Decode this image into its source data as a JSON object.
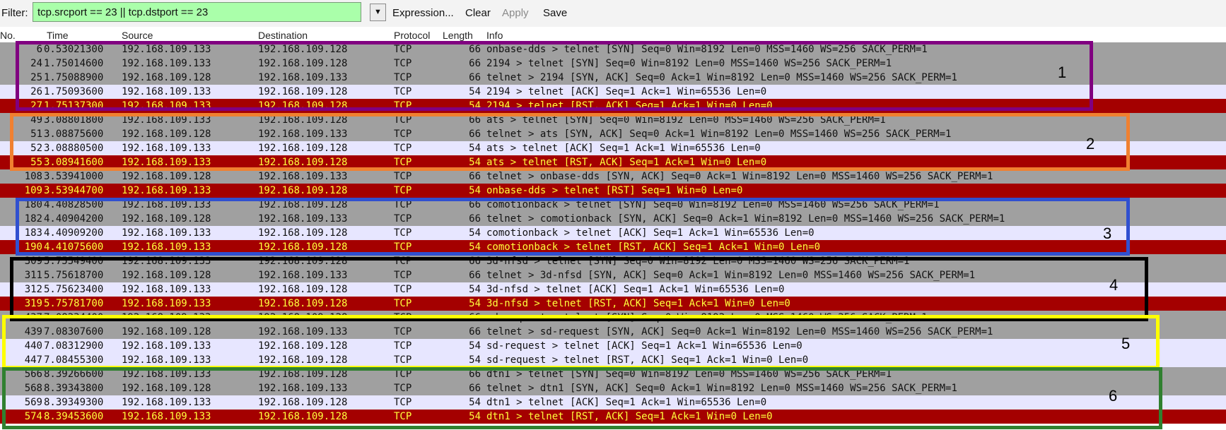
{
  "filter": {
    "label": "Filter:",
    "value": "tcp.srcport == 23 || tcp.dstport == 23",
    "dropdown_icon": "triangle-down"
  },
  "toolbar": {
    "expression": "Expression...",
    "clear": "Clear",
    "apply": "Apply",
    "save": "Save"
  },
  "columns": {
    "no": "No.",
    "time": "Time",
    "source": "Source",
    "destination": "Destination",
    "protocol": "Protocol",
    "length": "Length",
    "info": "Info"
  },
  "colors": {
    "syn_row": "#a0a0a0",
    "ack_row": "#e7e6ff",
    "rst_row": "#a40000",
    "rst_text": "#ffff3c",
    "filter_bg": "#aaffaa"
  },
  "packets": [
    {
      "no": "6",
      "time": "0.53021300",
      "src": "192.168.109.133",
      "dst": "192.168.109.128",
      "proto": "TCP",
      "len": "66",
      "info": "onbase-dds > telnet [SYN] Seq=0 Win=8192 Len=0 MSS=1460 WS=256 SACK_PERM=1",
      "kind": "syn"
    },
    {
      "no": "24",
      "time": "1.75014600",
      "src": "192.168.109.133",
      "dst": "192.168.109.128",
      "proto": "TCP",
      "len": "66",
      "info": "2194 > telnet [SYN] Seq=0 Win=8192 Len=0 MSS=1460 WS=256 SACK_PERM=1",
      "kind": "syn"
    },
    {
      "no": "25",
      "time": "1.75088900",
      "src": "192.168.109.128",
      "dst": "192.168.109.133",
      "proto": "TCP",
      "len": "66",
      "info": "telnet > 2194 [SYN, ACK] Seq=0 Ack=1 Win=8192 Len=0 MSS=1460 WS=256 SACK_PERM=1",
      "kind": "synack"
    },
    {
      "no": "26",
      "time": "1.75093600",
      "src": "192.168.109.133",
      "dst": "192.168.109.128",
      "proto": "TCP",
      "len": "54",
      "info": "2194 > telnet [ACK] Seq=1 Ack=1 Win=65536 Len=0",
      "kind": "ack"
    },
    {
      "no": "27",
      "time": "1.75137300",
      "src": "192.168.109.133",
      "dst": "192.168.109.128",
      "proto": "TCP",
      "len": "54",
      "info": "2194 > telnet [RST, ACK] Seq=1 Ack=1 Win=0 Len=0",
      "kind": "rst"
    },
    {
      "no": "49",
      "time": "3.08801800",
      "src": "192.168.109.133",
      "dst": "192.168.109.128",
      "proto": "TCP",
      "len": "66",
      "info": "ats > telnet [SYN] Seq=0 Win=8192 Len=0 MSS=1460 WS=256 SACK_PERM=1",
      "kind": "syn"
    },
    {
      "no": "51",
      "time": "3.08875600",
      "src": "192.168.109.128",
      "dst": "192.168.109.133",
      "proto": "TCP",
      "len": "66",
      "info": "telnet > ats [SYN, ACK] Seq=0 Ack=1 Win=8192 Len=0 MSS=1460 WS=256 SACK_PERM=1",
      "kind": "synack"
    },
    {
      "no": "52",
      "time": "3.08880500",
      "src": "192.168.109.133",
      "dst": "192.168.109.128",
      "proto": "TCP",
      "len": "54",
      "info": "ats > telnet [ACK] Seq=1 Ack=1 Win=65536 Len=0",
      "kind": "ack"
    },
    {
      "no": "55",
      "time": "3.08941600",
      "src": "192.168.109.133",
      "dst": "192.168.109.128",
      "proto": "TCP",
      "len": "54",
      "info": "ats > telnet [RST, ACK] Seq=1 Ack=1 Win=0 Len=0",
      "kind": "rst"
    },
    {
      "no": "108",
      "time": "3.53941000",
      "src": "192.168.109.128",
      "dst": "192.168.109.133",
      "proto": "TCP",
      "len": "66",
      "info": "telnet > onbase-dds [SYN, ACK] Seq=0 Ack=1 Win=8192 Len=0 MSS=1460 WS=256 SACK_PERM=1",
      "kind": "synack"
    },
    {
      "no": "109",
      "time": "3.53944700",
      "src": "192.168.109.133",
      "dst": "192.168.109.128",
      "proto": "TCP",
      "len": "54",
      "info": "onbase-dds > telnet [RST] Seq=1 Win=0 Len=0",
      "kind": "rst"
    },
    {
      "no": "180",
      "time": "4.40828500",
      "src": "192.168.109.133",
      "dst": "192.168.109.128",
      "proto": "TCP",
      "len": "66",
      "info": "comotionback > telnet [SYN] Seq=0 Win=8192 Len=0 MSS=1460 WS=256 SACK_PERM=1",
      "kind": "syn"
    },
    {
      "no": "182",
      "time": "4.40904200",
      "src": "192.168.109.128",
      "dst": "192.168.109.133",
      "proto": "TCP",
      "len": "66",
      "info": "telnet > comotionback [SYN, ACK] Seq=0 Ack=1 Win=8192 Len=0 MSS=1460 WS=256 SACK_PERM=1",
      "kind": "synack"
    },
    {
      "no": "183",
      "time": "4.40909200",
      "src": "192.168.109.133",
      "dst": "192.168.109.128",
      "proto": "TCP",
      "len": "54",
      "info": "comotionback > telnet [ACK] Seq=1 Ack=1 Win=65536 Len=0",
      "kind": "ack"
    },
    {
      "no": "190",
      "time": "4.41075600",
      "src": "192.168.109.133",
      "dst": "192.168.109.128",
      "proto": "TCP",
      "len": "54",
      "info": "comotionback > telnet [RST, ACK] Seq=1 Ack=1 Win=0 Len=0",
      "kind": "rst"
    },
    {
      "no": "309",
      "time": "5.75549400",
      "src": "192.168.109.133",
      "dst": "192.168.109.128",
      "proto": "TCP",
      "len": "66",
      "info": "3d-nfsd > telnet [SYN] Seq=0 Win=8192 Len=0 MSS=1460 WS=256 SACK_PERM=1",
      "kind": "syn"
    },
    {
      "no": "311",
      "time": "5.75618700",
      "src": "192.168.109.128",
      "dst": "192.168.109.133",
      "proto": "TCP",
      "len": "66",
      "info": "telnet > 3d-nfsd [SYN, ACK] Seq=0 Ack=1 Win=8192 Len=0 MSS=1460 WS=256 SACK_PERM=1",
      "kind": "synack"
    },
    {
      "no": "312",
      "time": "5.75623400",
      "src": "192.168.109.133",
      "dst": "192.168.109.128",
      "proto": "TCP",
      "len": "54",
      "info": "3d-nfsd > telnet [ACK] Seq=1 Ack=1 Win=65536 Len=0",
      "kind": "ack"
    },
    {
      "no": "319",
      "time": "5.75781700",
      "src": "192.168.109.133",
      "dst": "192.168.109.128",
      "proto": "TCP",
      "len": "54",
      "info": "3d-nfsd > telnet [RST, ACK] Seq=1 Ack=1 Win=0 Len=0",
      "kind": "rst"
    },
    {
      "no": "437",
      "time": "7.08234400",
      "src": "192.168.109.133",
      "dst": "192.168.109.128",
      "proto": "TCP",
      "len": "66",
      "info": "sd-request > telnet [SYN] Seq=0 Win=8192 Len=0 MSS=1460 WS=256 SACK_PERM=1",
      "kind": "syn"
    },
    {
      "no": "439",
      "time": "7.08307600",
      "src": "192.168.109.128",
      "dst": "192.168.109.133",
      "proto": "TCP",
      "len": "66",
      "info": "telnet > sd-request [SYN, ACK] Seq=0 Ack=1 Win=8192 Len=0 MSS=1460 WS=256 SACK_PERM=1",
      "kind": "synack"
    },
    {
      "no": "440",
      "time": "7.08312900",
      "src": "192.168.109.133",
      "dst": "192.168.109.128",
      "proto": "TCP",
      "len": "54",
      "info": "sd-request > telnet [ACK] Seq=1 Ack=1 Win=65536 Len=0",
      "kind": "ack"
    },
    {
      "no": "447",
      "time": "7.08455300",
      "src": "192.168.109.133",
      "dst": "192.168.109.128",
      "proto": "TCP",
      "len": "54",
      "info": "sd-request > telnet [RST, ACK] Seq=1 Ack=1 Win=0 Len=0",
      "kind": "ack"
    },
    {
      "no": "566",
      "time": "8.39266600",
      "src": "192.168.109.133",
      "dst": "192.168.109.128",
      "proto": "TCP",
      "len": "66",
      "info": "dtn1 > telnet [SYN] Seq=0 Win=8192 Len=0 MSS=1460 WS=256 SACK_PERM=1",
      "kind": "syn"
    },
    {
      "no": "568",
      "time": "8.39343800",
      "src": "192.168.109.128",
      "dst": "192.168.109.133",
      "proto": "TCP",
      "len": "66",
      "info": "telnet > dtn1 [SYN, ACK] Seq=0 Ack=1 Win=8192 Len=0 MSS=1460 WS=256 SACK_PERM=1",
      "kind": "synack"
    },
    {
      "no": "569",
      "time": "8.39349300",
      "src": "192.168.109.133",
      "dst": "192.168.109.128",
      "proto": "TCP",
      "len": "54",
      "info": "dtn1 > telnet [ACK] Seq=1 Ack=1 Win=65536 Len=0",
      "kind": "ack"
    },
    {
      "no": "574",
      "time": "8.39453600",
      "src": "192.168.109.133",
      "dst": "192.168.109.128",
      "proto": "TCP",
      "len": "54",
      "info": "dtn1 > telnet [RST, ACK] Seq=1 Ack=1 Win=0 Len=0",
      "kind": "rst"
    }
  ],
  "groups": [
    {
      "label": "1",
      "color": "#800080"
    },
    {
      "label": "2",
      "color": "#f08030"
    },
    {
      "label": "3",
      "color": "#3050d0"
    },
    {
      "label": "4",
      "color": "#000000"
    },
    {
      "label": "5",
      "color": "#ffff00"
    },
    {
      "label": "6",
      "color": "#308030"
    }
  ]
}
